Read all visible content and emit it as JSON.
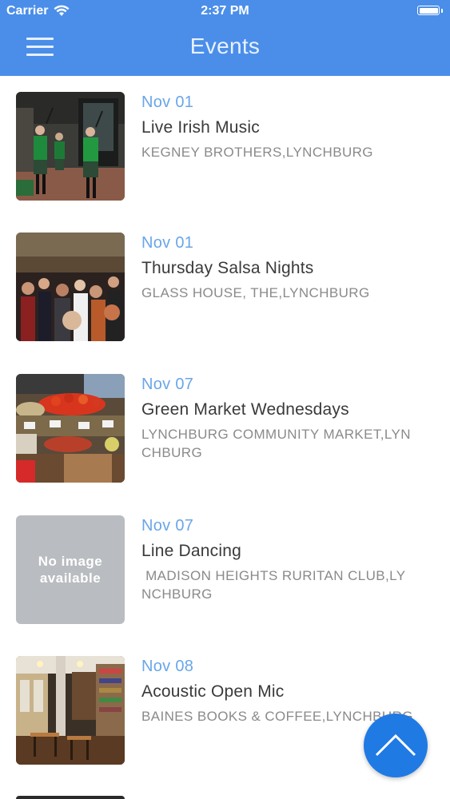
{
  "status": {
    "carrier": "Carrier",
    "time": "2:37 PM"
  },
  "header": {
    "title": "Events",
    "menu_icon": "hamburger-menu-icon"
  },
  "events": [
    {
      "date": "Nov 01",
      "name": "Live Irish Music",
      "venue": "KEGNEY BROTHERS,LYNCHBURG"
    },
    {
      "date": "Nov 01",
      "name": "Thursday Salsa Nights",
      "venue": "GLASS HOUSE, THE,LYNCHBURG"
    },
    {
      "date": "Nov 07",
      "name": "Green Market Wednesdays",
      "venue": "LYNCHBURG COMMUNITY MARKET,LYNCHBURG"
    },
    {
      "date": "Nov 07",
      "name": "Line Dancing",
      "venue": " MADISON HEIGHTS RURITAN CLUB,LYNCHBURG",
      "image_text_1": "No image",
      "image_text_2": "available"
    },
    {
      "date": "Nov 08",
      "name": "Acoustic Open Mic",
      "venue": "BAINES BOOKS & COFFEE,LYNCHBURG"
    }
  ],
  "fab": {
    "icon": "chevron-up-icon"
  },
  "colors": {
    "header": "#4a8ee9",
    "date": "#6aa6e8",
    "fab": "#1f7ae4"
  }
}
